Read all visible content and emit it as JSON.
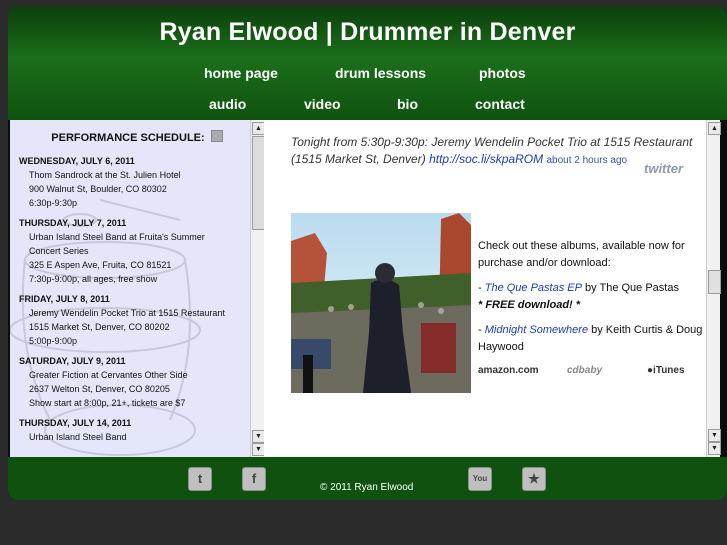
{
  "header": {
    "title": "Ryan Elwood | Drummer in Denver",
    "nav_row1": [
      "home page",
      "drum lessons",
      "photos"
    ],
    "nav_row2": [
      "audio",
      "video",
      "bio",
      "contact"
    ]
  },
  "schedule": {
    "heading": "PERFORMANCE SCHEDULE:",
    "events": [
      {
        "date": "WEDNESDAY, JULY 6, 2011",
        "lines": [
          "Thom Sandrock at the St. Julien Hotel",
          "900 Walnut St, Boulder, CO 80302",
          "6:30p-9:30p"
        ]
      },
      {
        "date": "THURSDAY, JULY 7, 2011",
        "lines": [
          "Urban Island Steel Band at Fruita's Summer",
          "Concert Series",
          "325 E Aspen Ave, Fruita, CO 81521",
          "7:30p-9:00p, all ages, free show"
        ]
      },
      {
        "date": "FRIDAY, JULY 8, 2011",
        "lines": [
          "Jeremy Wendelin Pocket Trio at 1515 Restaurant",
          "1515 Market St, Denver, CO 80202",
          "5:00p-9:00p"
        ]
      },
      {
        "date": "SATURDAY, JULY 9, 2011",
        "lines": [
          "Greater Fiction at Cervantes Other Side",
          "2637 Welton St, Denver, CO 80205",
          "Show start at 8:00p, 21+, tickets are $7"
        ]
      },
      {
        "date": "THURSDAY, JULY 14, 2011",
        "lines": [
          "Urban Island Steel Band"
        ]
      }
    ]
  },
  "tweet": {
    "text": "Tonight from 5:30p-9:30p: Jeremy Wendelin Pocket Trio at 1515 Restaurant (1515 Market St, Denver) ",
    "link": "http://soc.li/skpaROM",
    "ago": "about 2 hours ago",
    "logo": "twitter"
  },
  "albums": {
    "intro": "Check out these albums, available now for purchase and/or download:",
    "album1_dash": "- ",
    "album1_title": "The Que Pastas EP",
    "album1_by": " by The Que Pastas",
    "album1_note": "* FREE download! *",
    "album2_dash": "- ",
    "album2_title": "Midnight Somewhere",
    "album2_by": " by Keith Curtis & Doug Haywood",
    "stores": [
      "amazon.com",
      "cdbaby",
      "iTunes"
    ]
  },
  "footer": {
    "copyright": "© 2011 Ryan Elwood",
    "icons": [
      "twitter-icon",
      "facebook-icon",
      "youtube-icon",
      "reverbnation-icon"
    ]
  }
}
